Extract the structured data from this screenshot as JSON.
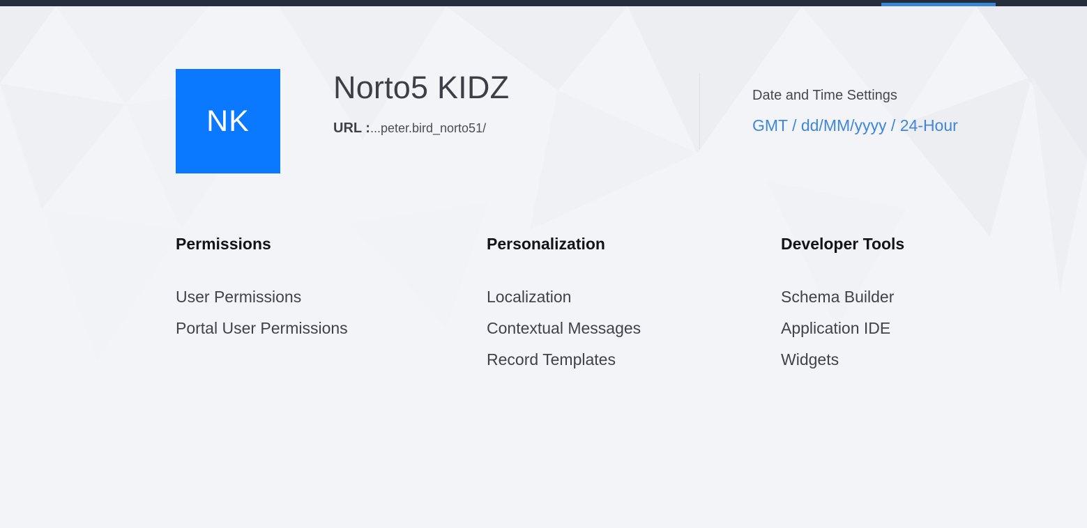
{
  "org": {
    "initials": "NK",
    "name": "Norto5 KIDZ",
    "url_label": "URL :",
    "url_value": "...peter.bird_norto51/"
  },
  "datetime": {
    "label": "Date and Time Settings",
    "value": "GMT / dd/MM/yyyy / 24-Hour"
  },
  "sections": [
    {
      "title": "Permissions",
      "items": [
        "User Permissions",
        "Portal User Permissions"
      ]
    },
    {
      "title": "Personalization",
      "items": [
        "Localization",
        "Contextual Messages",
        "Record Templates"
      ]
    },
    {
      "title": "Developer Tools",
      "items": [
        "Schema Builder",
        "Application IDE",
        "Widgets"
      ]
    }
  ],
  "colors": {
    "avatar_bg": "#0a78ff",
    "link": "#3f87d6",
    "topbar": "#262d3c",
    "topbar_active": "#3a86d6",
    "page_bg": "#f3f4f7"
  }
}
